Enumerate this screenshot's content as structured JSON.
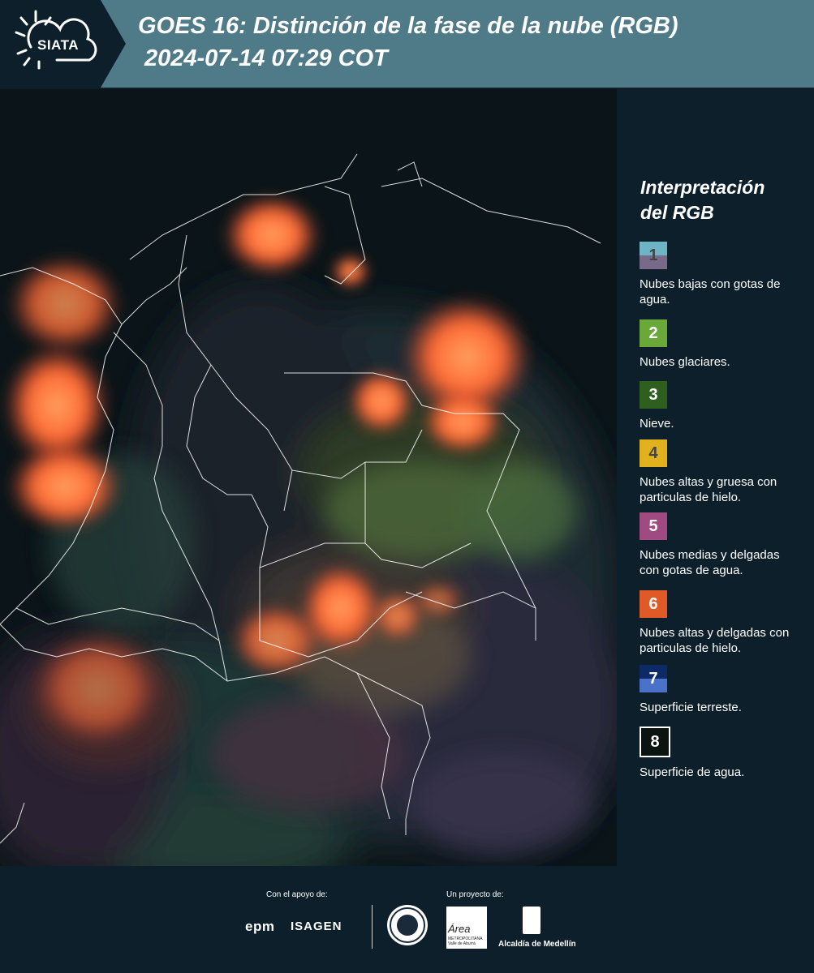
{
  "header": {
    "logo_text": "SIATA",
    "title_line1": "GOES 16: Distinción de la fase de la nube (RGB)",
    "title_line2": "2024-07-14 07:29 COT"
  },
  "legend": {
    "title_line1": "Interpretación",
    "title_line2": "del RGB",
    "items": [
      {
        "num": "1",
        "label": "Nubes bajas con gotas de agua.",
        "color_top": "#6db5c4",
        "color_bottom": "#7a6a8a",
        "num_color": "#444444"
      },
      {
        "num": "2",
        "label": "Nubes glaciares.",
        "color_top": "#6aa83a",
        "color_bottom": "#6aa83a",
        "num_color": "#ffffff"
      },
      {
        "num": "3",
        "label": "Nieve.",
        "color_top": "#2f5f1f",
        "color_bottom": "#2f5f1f",
        "num_color": "#ffffff"
      },
      {
        "num": "4",
        "label": "Nubes altas y gruesa con particulas de hielo.",
        "color_top": "#e1b21e",
        "color_bottom": "#e1b21e",
        "num_color": "#444444"
      },
      {
        "num": "5",
        "label": "Nubes medias y delgadas con gotas de agua.",
        "color_top": "#a04a82",
        "color_bottom": "#a04a82",
        "num_color": "#ffffff"
      },
      {
        "num": "6",
        "label": "Nubes altas y delgadas con particulas de hielo.",
        "color_top": "#e05a28",
        "color_bottom": "#e05a28",
        "num_color": "#ffffff"
      },
      {
        "num": "7",
        "label": "Superficie terreste.",
        "color_top": "#0d2a66",
        "color_bottom": "#4a72c8",
        "num_color": "#ffffff"
      },
      {
        "num": "8",
        "label": "Superficie de agua.",
        "color_top": "#0a1410",
        "color_bottom": "#0a1410",
        "num_color": "#ffffff"
      }
    ]
  },
  "footer": {
    "support_label": "Con el apoyo de:",
    "project_label": "Un proyecto de:",
    "epm": "epm",
    "isagen": "ISAGEN",
    "area_logo_text": "Área",
    "area_sub": "METROPOLITANA Valle de Aburrá",
    "alcaldia": "Alcaldía de Medellín"
  },
  "colors": {
    "header_bg": "#4f7a87",
    "page_bg": "#0d1f2b",
    "cloud_orange": "#ff6a35"
  }
}
